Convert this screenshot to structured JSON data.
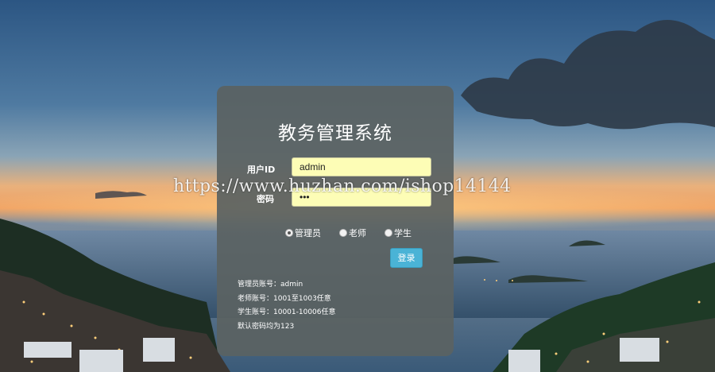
{
  "page": {
    "title": "教务管理系统"
  },
  "form": {
    "user_id_label": "用户ID",
    "user_id_value": "admin",
    "password_label": "密码",
    "password_value": "•••"
  },
  "roles": [
    {
      "label": "管理员",
      "selected": true
    },
    {
      "label": "老师",
      "selected": false
    },
    {
      "label": "学生",
      "selected": false
    }
  ],
  "login_button": "登录",
  "info": [
    "管理员账号：admin",
    "老师账号：1001至1003任意",
    "学生账号：10001-10006任意",
    "默认密码均为123"
  ],
  "watermark": "https://www.huzhan.com/ishop14144",
  "colors": {
    "panel": "#5a6262",
    "input_bg": "#fdfdb6",
    "button": "#4ab3d6"
  }
}
